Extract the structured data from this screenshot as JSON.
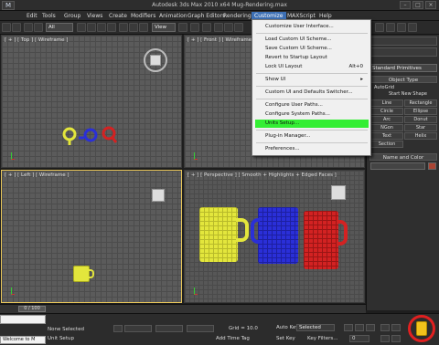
{
  "window": {
    "logo": "M",
    "title": "Autodesk 3ds Max 2010 x64     Mug-Rendering.max",
    "min_glyph": "–",
    "max_glyph": "□",
    "close_glyph": "×"
  },
  "menu": {
    "items": [
      {
        "label": "Edit"
      },
      {
        "label": "Tools"
      },
      {
        "label": "Group"
      },
      {
        "label": "Views"
      },
      {
        "label": "Create"
      },
      {
        "label": "Modifiers"
      },
      {
        "label": "Animation"
      },
      {
        "label": "Graph Editors"
      },
      {
        "label": "Rendering"
      },
      {
        "label": "Customize"
      },
      {
        "label": "MAXScript"
      },
      {
        "label": "Help"
      }
    ]
  },
  "toolbar": {
    "selection_filter": "All",
    "reference_coord": "View"
  },
  "dropdown": {
    "items": [
      {
        "label": "Customize User Interface...",
        "shortcut": ""
      },
      {
        "label": "Load Custom UI Scheme...",
        "shortcut": ""
      },
      {
        "label": "Save Custom UI Scheme...",
        "shortcut": ""
      },
      {
        "label": "Revert to Startup Layout",
        "shortcut": ""
      },
      {
        "label": "Lock UI Layout",
        "shortcut": "Alt+0"
      },
      {
        "label": "Show UI",
        "shortcut": "▸"
      },
      {
        "label": "Custom UI and Defaults Switcher...",
        "shortcut": ""
      },
      {
        "label": "Configure User Paths...",
        "shortcut": ""
      },
      {
        "label": "Configure System Paths...",
        "shortcut": ""
      },
      {
        "label": "Units Setup...",
        "shortcut": ""
      },
      {
        "label": "Plug-in Manager...",
        "shortcut": ""
      },
      {
        "label": "Preferences...",
        "shortcut": ""
      }
    ],
    "highlight_color": "#33ee33"
  },
  "viewports": {
    "top": "[ + ] [ Top ] [ Wireframe ]",
    "front": "[ + ] [ Front ] [ Wireframe ]",
    "left": "[ + ] [ Left ] [ Wireframe ]",
    "perspective": "[ + ] [ Perspective ] [ Smooth + Highlights + Edged Faces ]"
  },
  "command_panel": {
    "category": "Standard Primitives",
    "object_type_header": "Object Type",
    "autogrid": "AutoGrid",
    "start_new_shape": "Start New Shape",
    "buttons": [
      "Line",
      "Rectangle",
      "Circle",
      "Ellipse",
      "Arc",
      "Donut",
      "NGon",
      "Star",
      "Text",
      "Helix",
      "Section"
    ],
    "name_color_header": "Name and Color"
  },
  "timeline": {
    "frame": "0 / 100"
  },
  "status": {
    "script_label": "Welcome to M",
    "selection": "None Selected",
    "unit_setup": "Unit Setup",
    "grid": "Grid = 10.0",
    "add_time_tag": "Add Time Tag",
    "auto_key": "Auto Key",
    "set_key": "Set Key",
    "selected": "Selected",
    "key_filters": "Key Filters...",
    "frame_value": "0"
  },
  "colors": {
    "yellow": "#e3e63c",
    "blue": "#2a2fd8",
    "red": "#d32222",
    "highlight_circle": "#e02020"
  }
}
